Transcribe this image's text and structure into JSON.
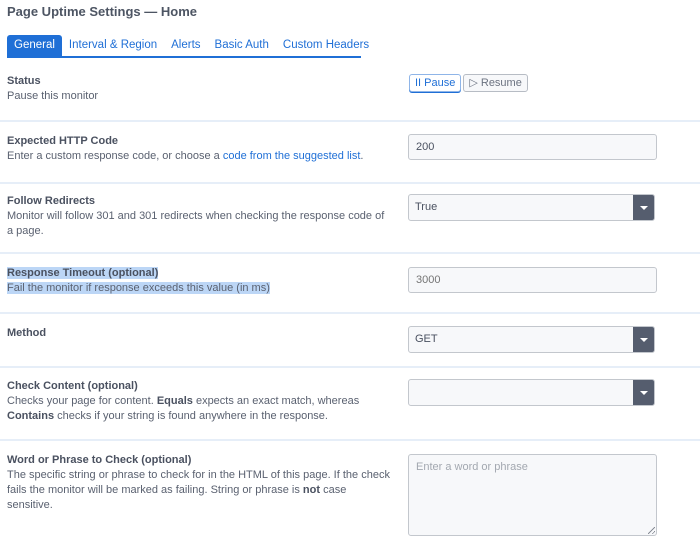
{
  "header": {
    "title": "Page Uptime Settings — Home"
  },
  "tabs": [
    {
      "label": "General",
      "active": true
    },
    {
      "label": "Interval & Region",
      "active": false
    },
    {
      "label": "Alerts",
      "active": false
    },
    {
      "label": "Basic Auth",
      "active": false
    },
    {
      "label": "Custom Headers",
      "active": false
    }
  ],
  "status": {
    "title": "Status",
    "description": "Pause this monitor",
    "pause_label": "II Pause",
    "resume_label": "▷ Resume"
  },
  "expected_http_code": {
    "title": "Expected HTTP Code",
    "description_prefix": "Enter a custom response code, or choose a ",
    "link_text": "code from the suggested list",
    "description_suffix": ".",
    "value": "200"
  },
  "follow_redirects": {
    "title": "Follow Redirects",
    "description": "Monitor will follow 301 and 301 redirects when checking the response code of a page.",
    "selected": "True"
  },
  "response_timeout": {
    "title": "Response Timeout (optional)",
    "description": "Fail the monitor if response exceeds this value (in ms)",
    "value": "",
    "placeholder": "3000"
  },
  "method": {
    "title": "Method",
    "selected": "GET"
  },
  "check_content": {
    "title": "Check Content (optional)",
    "desc_1": "Checks your page for content. ",
    "bold_1": "Equals",
    "desc_2": " expects an exact match, whereas ",
    "bold_2": "Contains",
    "desc_3": " checks if your string is found anywhere in the response.",
    "selected": ""
  },
  "word_phrase": {
    "title": "Word or Phrase to Check (optional)",
    "desc_1": "The specific string or phrase to check for in the HTML of this page. If the check fails the monitor will be marked as failing. String or phrase is ",
    "bold_1": "not",
    "desc_2": " case sensitive.",
    "value": "",
    "placeholder": "Enter a word or phrase"
  }
}
